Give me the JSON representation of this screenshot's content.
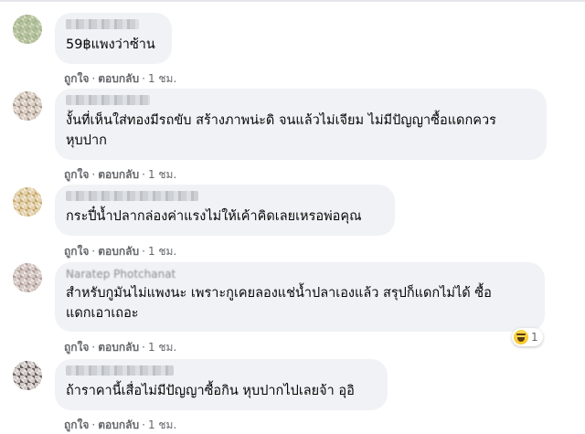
{
  "actions": {
    "like": "ถูกใจ",
    "reply": "ตอบกลับ",
    "time": "1 ชม.",
    "dot": "·"
  },
  "comments": [
    {
      "author": "",
      "text": "59฿แพงว่าซ้าน"
    },
    {
      "author": "",
      "text": "งั้นที่เห็นใส่ทองมีรถขับ สร้างภาพน่ะดิ จนแล้วไม่เจียม ไม่มีปัญญาซื้อแดกควร\nหุบปาก"
    },
    {
      "author": "",
      "text": "กระปี๋น้ำปลากล่องค่าแรงไม่ให้เค้าคิดเลยเหรอพ่อคุณ"
    },
    {
      "author": "Naratep Photchanat",
      "text": "สำหรับกูมันไม่แพงนะ เพราะกูเคยลองแช่น้ำปลาเองแล้ว สรุปก็แดกไม่ได้ ซื้อ\nแดกเอาเถอะ",
      "reaction_count": "1",
      "reaction_icon": "haha-reaction-icon"
    },
    {
      "author": "",
      "text": "ถ้าราคานี้เสื่อไม่มีปัญญาซื้อกิน หุบปากไปเลยจ้า อุอิ"
    }
  ]
}
